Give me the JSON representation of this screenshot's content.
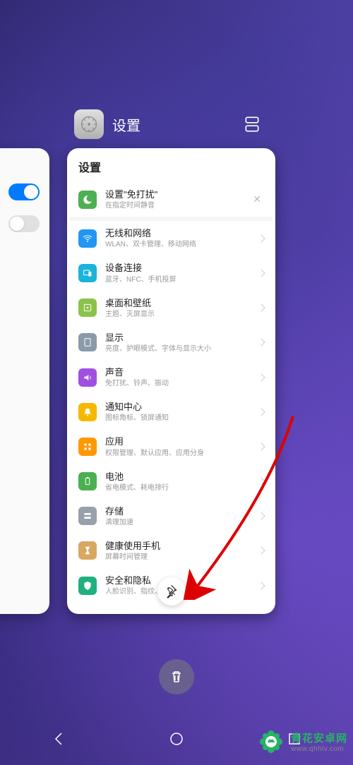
{
  "header": {
    "app_name": "设置"
  },
  "card": {
    "title": "设置",
    "items": [
      {
        "title": "设置\"免打扰\"",
        "sub": "在指定时间静音",
        "color": "ic-green",
        "close": true
      },
      {
        "title": "无线和网络",
        "sub": "WLAN、双卡管理、移动网络",
        "color": "ic-blue"
      },
      {
        "title": "设备连接",
        "sub": "蓝牙、NFC、手机投屏",
        "color": "ic-teal"
      },
      {
        "title": "桌面和壁纸",
        "sub": "主题、灭屏显示",
        "color": "ic-lime"
      },
      {
        "title": "显示",
        "sub": "亮度、护眼模式、字体与显示大小",
        "color": "ic-grey"
      },
      {
        "title": "声音",
        "sub": "免打扰、铃声、振动",
        "color": "ic-purple"
      },
      {
        "title": "通知中心",
        "sub": "图标角标、锁屏通知",
        "color": "ic-yellow"
      },
      {
        "title": "应用",
        "sub": "权限管理、默认应用、应用分身",
        "color": "ic-orange"
      },
      {
        "title": "电池",
        "sub": "省电模式、耗电排行",
        "color": "ic-greenb"
      },
      {
        "title": "存储",
        "sub": "清理加速",
        "color": "ic-grey2"
      },
      {
        "title": "健康使用手机",
        "sub": "屏幕时间管理",
        "color": "ic-sand"
      },
      {
        "title": "安全和隐私",
        "sub": "人脸识别、指纹、密码保险箱",
        "color": "ic-teal2"
      }
    ]
  },
  "watermark": {
    "name": "青花安卓网",
    "url": "www.qhhlv.com"
  }
}
